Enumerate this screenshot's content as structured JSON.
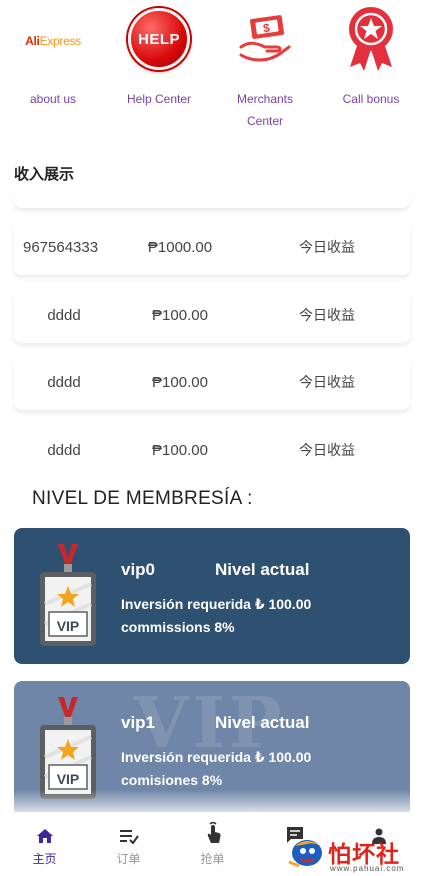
{
  "quick_links": [
    {
      "label": "about us",
      "icon": "aliexpress-logo",
      "logo_brand": "Ali",
      "logo_suffix": "Express"
    },
    {
      "label": "Help Center",
      "icon": "help-badge-icon",
      "badge_text": "HELP"
    },
    {
      "label": "Merchants Center",
      "icon": "money-hand-icon"
    },
    {
      "label": "Call bonus",
      "icon": "award-ribbon-icon"
    }
  ],
  "income": {
    "title": "收入展示",
    "rows": [
      {
        "account": "967564333",
        "amount": "₱1000.00",
        "label": "今日收益"
      },
      {
        "account": "dddd",
        "amount": "₱100.00",
        "label": "今日收益"
      },
      {
        "account": "dddd",
        "amount": "₱100.00",
        "label": "今日收益"
      },
      {
        "account": "dddd",
        "amount": "₱100.00",
        "label": "今日收益"
      }
    ]
  },
  "membership": {
    "title": "NIVEL DE MEMBRESÍA :",
    "cards": [
      {
        "name": "vip0",
        "status": "Nivel actual",
        "requirement": "Inversión requerida ₺ 100.00",
        "commission": "commissions 8%",
        "badge_text": "VIP",
        "color": "#2e5172"
      },
      {
        "name": "vip1",
        "status": "Nivel actual",
        "requirement": "Inversión requerida ₺ 100.00",
        "commission": "comisiones 8%",
        "badge_text": "VIP",
        "watermark": "VIP",
        "color": "#6f86a8"
      }
    ]
  },
  "bottom_nav": [
    {
      "label": "主页",
      "icon": "home-icon",
      "active": true
    },
    {
      "label": "订单",
      "icon": "order-list-icon",
      "active": false
    },
    {
      "label": "抢单",
      "icon": "tap-hand-icon",
      "active": false
    },
    {
      "label": "",
      "icon": "chat-icon",
      "active": false
    },
    {
      "label": "",
      "icon": "person-icon",
      "active": false
    }
  ],
  "watermark": {
    "text": "怕坏社区",
    "url": "www.pahuai.com"
  },
  "colors": {
    "accent": "#3b2a9e",
    "link": "#7b3fa8",
    "card_dark": "#2e5172",
    "card_light": "#6f86a8"
  }
}
